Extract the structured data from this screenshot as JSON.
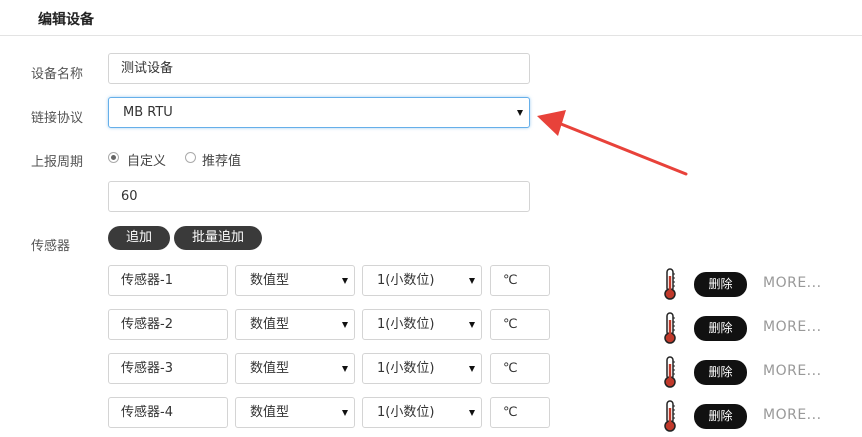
{
  "page": {
    "title": "编辑设备"
  },
  "form": {
    "device_name": {
      "label": "设备名称",
      "value": "测试设备"
    },
    "protocol": {
      "label": "链接协议",
      "value": "MB RTU"
    },
    "report_period": {
      "label": "上报周期",
      "options": [
        "自定义",
        "推荐值"
      ],
      "selected": "自定义",
      "value": "60"
    },
    "sensors": {
      "label": "传感器",
      "add_label": "追加",
      "batch_add_label": "批量追加",
      "delete_label": "删除",
      "more_label": "MORE...",
      "items": [
        {
          "name": "传感器-1",
          "type": "数值型",
          "precision": "1(小数位)",
          "unit": "℃",
          "icon": "thermometer-icon"
        },
        {
          "name": "传感器-2",
          "type": "数值型",
          "precision": "1(小数位)",
          "unit": "℃",
          "icon": "thermometer-icon"
        },
        {
          "name": "传感器-3",
          "type": "数值型",
          "precision": "1(小数位)",
          "unit": "℃",
          "icon": "thermometer-icon"
        },
        {
          "name": "传感器-4",
          "type": "数值型",
          "precision": "1(小数位)",
          "unit": "℃",
          "icon": "thermometer-icon"
        }
      ]
    }
  },
  "annotation": {
    "arrow_color": "#e8423a"
  }
}
